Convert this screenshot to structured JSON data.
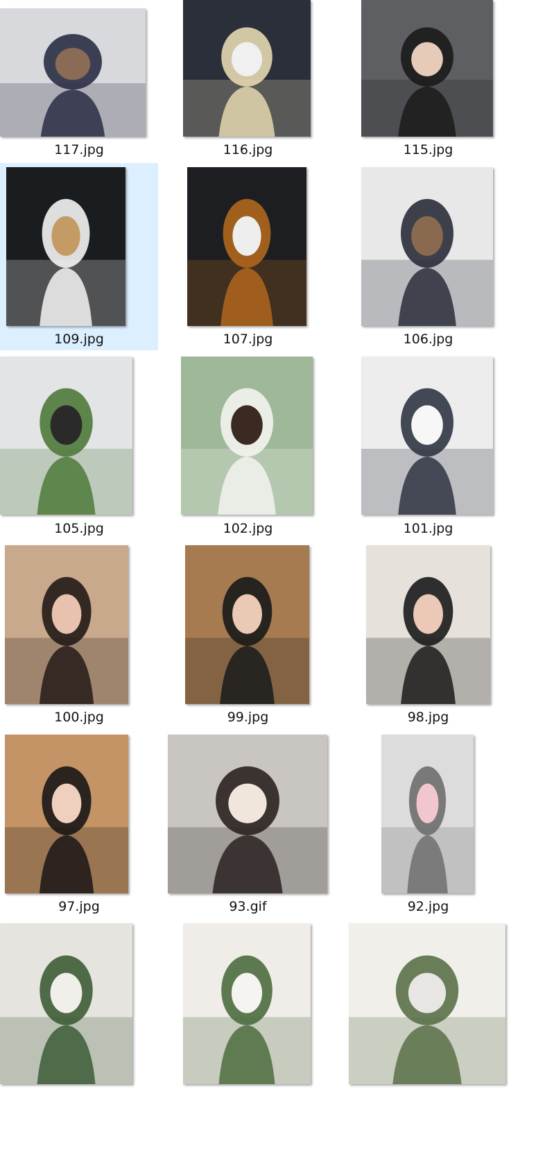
{
  "files": [
    {
      "name": "117.jpg",
      "selected": false,
      "palette": [
        "#d8d9dc",
        "#2a2d45",
        "#8a6b55"
      ]
    },
    {
      "name": "116.jpg",
      "selected": false,
      "palette": [
        "#2b2f3a",
        "#e4d8b0",
        "#f0f0f0"
      ]
    },
    {
      "name": "115.jpg",
      "selected": false,
      "palette": [
        "#5d5f63",
        "#1b1b1b",
        "#e6cbb8"
      ]
    },
    {
      "name": "109.jpg",
      "selected": true,
      "palette": [
        "#1a1d1f",
        "#f4f4f4",
        "#c49a65"
      ]
    },
    {
      "name": "107.jpg",
      "selected": false,
      "palette": [
        "#1c1e22",
        "#b0661d",
        "#eeeeee"
      ]
    },
    {
      "name": "106.jpg",
      "selected": false,
      "palette": [
        "#e8e8e8",
        "#2a2e3a",
        "#8a6a4e"
      ]
    },
    {
      "name": "105.jpg",
      "selected": false,
      "palette": [
        "#e2e4e6",
        "#4f7a3a",
        "#2a2a2a"
      ]
    },
    {
      "name": "102.jpg",
      "selected": false,
      "palette": [
        "#9fb89a",
        "#f3f3f0",
        "#3a2a22"
      ]
    },
    {
      "name": "101.jpg",
      "selected": false,
      "palette": [
        "#ededed",
        "#2f3542",
        "#f7f7f7"
      ]
    },
    {
      "name": "100.jpg",
      "selected": false,
      "palette": [
        "#c9a98b",
        "#241a17",
        "#e8c2ae"
      ]
    },
    {
      "name": "99.jpg",
      "selected": false,
      "palette": [
        "#a67b50",
        "#1a1a1a",
        "#eac9b5"
      ]
    },
    {
      "name": "98.jpg",
      "selected": false,
      "palette": [
        "#e6e1da",
        "#1b1b1b",
        "#ecc8b6"
      ]
    },
    {
      "name": "97.jpg",
      "selected": false,
      "palette": [
        "#c49466",
        "#1b1616",
        "#efcfbd"
      ]
    },
    {
      "name": "93.gif",
      "selected": false,
      "palette": [
        "#c9c6c2",
        "#2a2220",
        "#f1e6dc"
      ]
    },
    {
      "name": "92.jpg",
      "selected": false,
      "palette": [
        "#dcdcdc",
        "#6e6e6e",
        "#f2c6cf"
      ]
    },
    {
      "name": "",
      "selected": false,
      "palette": [
        "#e6e4df",
        "#3d5c36",
        "#f0efe9"
      ]
    },
    {
      "name": "",
      "selected": false,
      "palette": [
        "#f0ede8",
        "#4d6b3e",
        "#f6f4f0"
      ]
    },
    {
      "name": "",
      "selected": false,
      "palette": [
        "#f1efea",
        "#5a7048",
        "#e8e6e2"
      ]
    }
  ]
}
